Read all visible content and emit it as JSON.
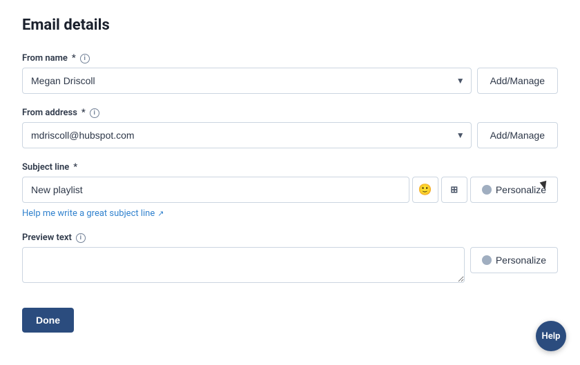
{
  "page": {
    "title": "Email details"
  },
  "form": {
    "from_name": {
      "label": "From name",
      "required": true,
      "value": "Megan Driscoll",
      "add_manage_label": "Add/Manage"
    },
    "from_address": {
      "label": "From address",
      "required": true,
      "value": "mdriscoll@hubspot.com",
      "add_manage_label": "Add/Manage"
    },
    "subject_line": {
      "label": "Subject line",
      "required": true,
      "value": "New playlist",
      "placeholder": "",
      "emoji_btn_label": "emoji",
      "tokens_btn_label": "tokens",
      "personalize_label": "Personalize",
      "help_link_text": "Help me write a great subject line"
    },
    "preview_text": {
      "label": "Preview text",
      "value": "",
      "placeholder": "",
      "personalize_label": "Personalize"
    }
  },
  "footer": {
    "done_label": "Done"
  },
  "help_bubble": {
    "label": "Help"
  }
}
